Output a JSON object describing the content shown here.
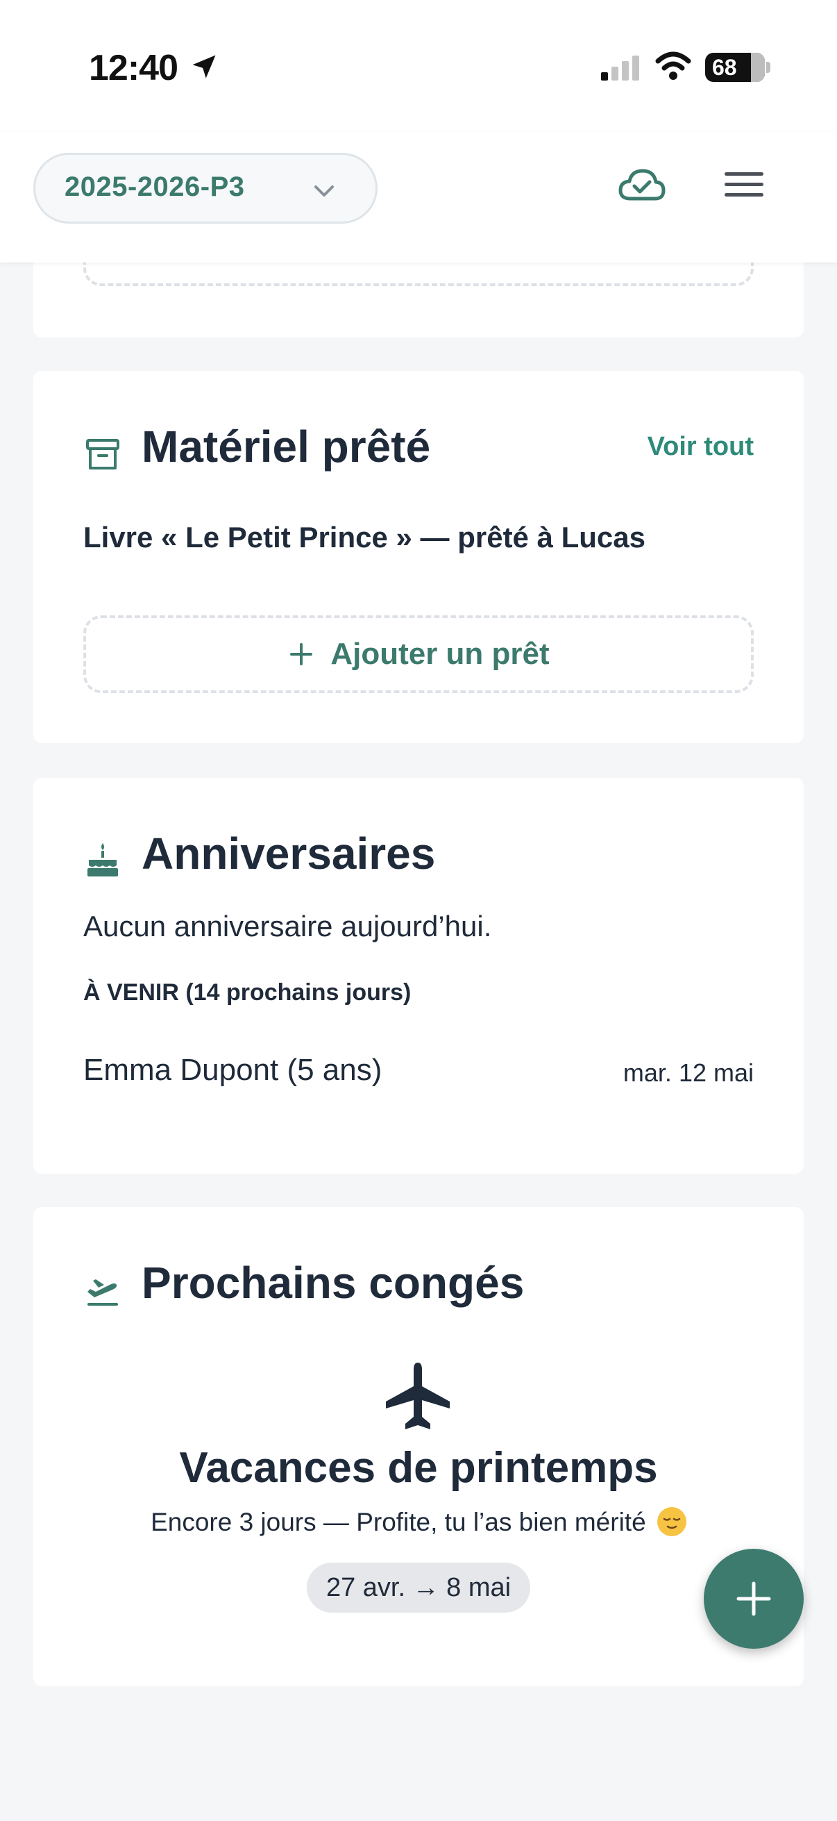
{
  "status_bar": {
    "time": "12:40",
    "battery": "68",
    "icons": [
      "location-arrow-icon",
      "signal-icon",
      "wifi-icon",
      "battery-icon"
    ]
  },
  "header": {
    "period": "2025-2026-P3",
    "icons": [
      "chevron-down-icon",
      "cloud-check-icon",
      "hamburger-menu-icon"
    ],
    "accent_color": "#3b7a6c"
  },
  "materiel": {
    "title": "Matériel prêté",
    "see_all": "Voir tout",
    "items": [
      "Livre « Le Petit Prince » — prêté à Lucas"
    ],
    "add_label": "Ajouter un prêt",
    "icon": "archive-box-icon"
  },
  "anniversaires": {
    "title": "Anniversaires",
    "none_today": "Aucun anniversaire aujourd’hui.",
    "upcoming_heading": "À VENIR (14 prochains jours)",
    "upcoming": [
      {
        "name": "Emma Dupont (5 ans)",
        "date": "mar. 12 mai"
      }
    ],
    "icon": "cake-icon"
  },
  "conges": {
    "title": "Prochains congés",
    "vacation_name": "Vacances de printemps",
    "message": "Encore 3 jours — Profite, tu l’as bien mérité",
    "date_range": "27 avr. → 8 mai",
    "icons": [
      "plane-departure-icon",
      "airplane-icon",
      "relieved-face-emoji"
    ]
  },
  "fab": {
    "icon": "plus-icon",
    "color": "#3e7b6f"
  }
}
